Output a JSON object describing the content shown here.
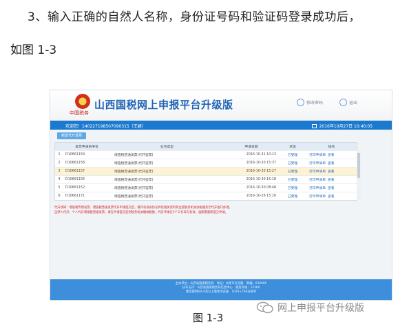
{
  "doc": {
    "line1": "3、输入正确的自然人名称，身份证号码和验证码登录成功后，",
    "line2": "如图 1-3",
    "caption": "图 1-3",
    "watermark": "网上申报平台升级版"
  },
  "app": {
    "emblem_caption": "中国税务",
    "title": "山西国税网上申报平台升级版",
    "header_links": [
      "修改密码",
      "退出"
    ]
  },
  "userbar": {
    "welcome": "欢迎您！140227198507090315（王颖）",
    "datetime": "2016年10月27日 10:40:05"
  },
  "panel": {
    "new_button": "新建代开发票",
    "columns": [
      "",
      "发票申请单序号",
      "业务类型",
      "申请日期",
      "状态",
      "操作"
    ],
    "rows": [
      {
        "no": "1",
        "id": "D10661159",
        "type": "增值税普通发票(代开鉴票)",
        "date": "2016-10-31 10:13",
        "status": "已受理",
        "op1": "打印申请单",
        "op2": "查看"
      },
      {
        "no": "2",
        "id": "D10661158",
        "type": "增值税普通发票(代开鉴票)",
        "date": "2016-10-30 15:37",
        "status": "已受理",
        "op1": "打印申请单",
        "op2": "查看"
      },
      {
        "no": "3",
        "id": "D10661157",
        "type": "增值税普通发票(代开鉴票)",
        "date": "2016-10-30 15:27",
        "status": "已受理",
        "op1": "打印申请单",
        "op2": "查看"
      },
      {
        "no": "4",
        "id": "D10661156",
        "type": "增值税普通发票(代开鉴票)",
        "date": "2016-10-30 15:18",
        "status": "已受理",
        "op1": "打印申请单",
        "op2": "查看"
      },
      {
        "no": "5",
        "id": "D10661152",
        "type": "增值税普通发票(代开鉴票)",
        "date": "2016-10-30 08:48",
        "status": "已受理",
        "op1": "打印申请单",
        "op2": "查看"
      },
      {
        "no": "6",
        "id": "D10661171",
        "type": "增值税普通发票(代开鉴票)",
        "date": "2016-10-26 15:16",
        "status": "已受理",
        "op1": "打印申请单",
        "op2": "查看"
      }
    ],
    "notes": [
      "代开须知：增值税专用发票、增值税普通发票代开申请提交后，请持有效身份证件及相关资料到主管税务机关办税服务厅代开窗口办理。",
      "自然人代开：个人代开增值税普通发票，请在申请提交后到税务机关缴纳税款，代开申请在5个工作日内有效，逾期需重新提交申请。"
    ]
  },
  "footer": {
    "lines": [
      "主办单位：山西省国家税务局　地址：太原市长治路　邮编：030006",
      "技术支持：山西省国家税务局信息中心　服务热线：12366",
      "建议使用IE8.0及以上版本浏览器　1024×768分辨率"
    ]
  }
}
